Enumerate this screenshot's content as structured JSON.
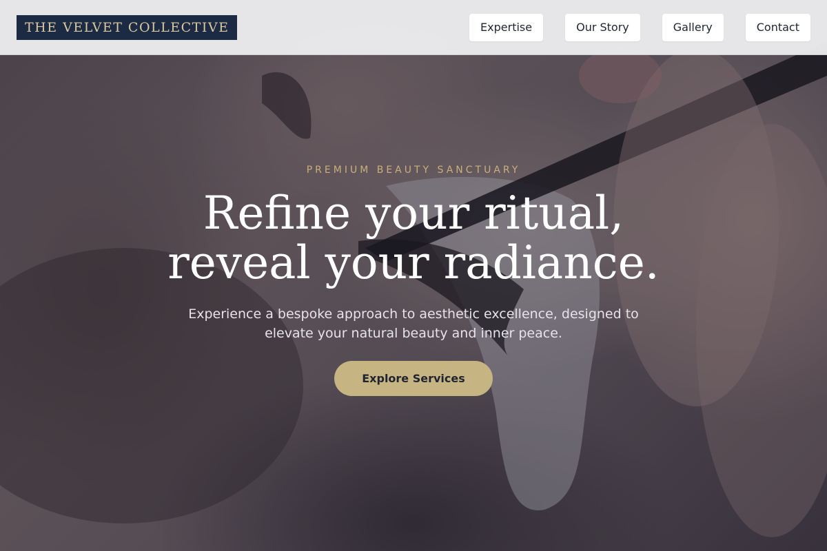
{
  "header": {
    "logo_text": "THE VELVET COLLECTIVE",
    "nav": [
      {
        "label": "Expertise"
      },
      {
        "label": "Our Story"
      },
      {
        "label": "Gallery"
      },
      {
        "label": "Contact"
      }
    ]
  },
  "hero": {
    "eyebrow": "PREMIUM BEAUTY SANCTUARY",
    "headline_line1": "Refine your ritual,",
    "headline_line2": "reveal your radiance.",
    "subtitle": "Experience a bespoke approach to aesthetic excellence, designed to elevate your natural beauty and inner peace.",
    "cta_label": "Explore Services"
  },
  "colors": {
    "logo_background": "#1d2a44",
    "logo_text": "#d9c9a0",
    "accent_gold": "#c7b483",
    "eyebrow_gold": "#c9b07c",
    "header_background": "#ececee"
  }
}
